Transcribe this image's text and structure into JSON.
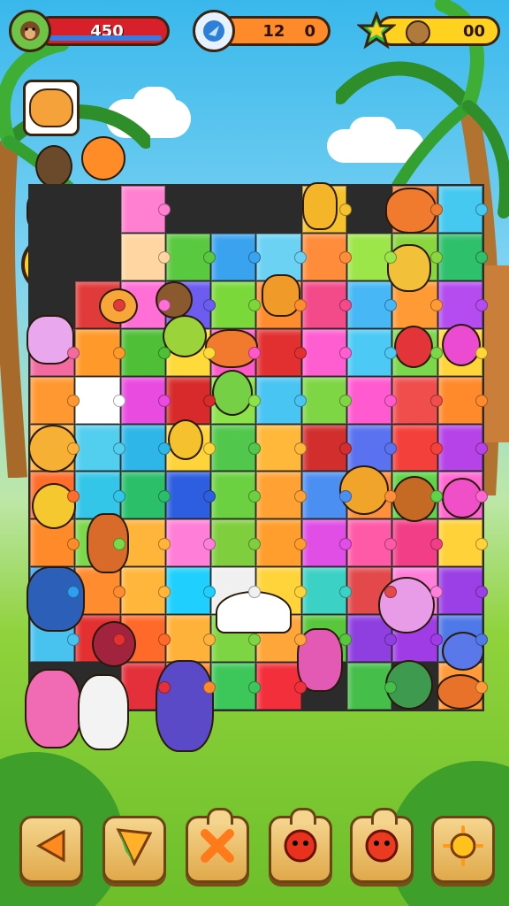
{
  "hud": {
    "lives": {
      "value": "450",
      "icon": "monkey-face-icon",
      "bar_color": "#d8202a",
      "bar_fill": 0.93
    },
    "timer": {
      "value": "12",
      "secondary": "0",
      "icon": "gem-icon",
      "color": "#ff8a2a"
    },
    "stars": {
      "value": "00",
      "icon": "star-icon",
      "friend_icon": "monkey-face-icon",
      "color": "#ffd21f"
    }
  },
  "sidebar": {
    "portraits": [
      "fox-portrait",
      "coconut-portrait",
      "pig-portrait",
      "bird-portrait"
    ]
  },
  "board": {
    "columns": 10,
    "rows": 11,
    "pieces": [
      "gap",
      "gap",
      "#ff7fd0",
      "gap",
      "gap",
      "gap",
      "#f6c22b",
      "gap",
      "#f07a2d",
      "#46c9f0",
      "gap",
      "gap",
      "#ffd6a1",
      "#59c93f",
      "#3aa3f0",
      "#6bd2f4",
      "#ff8c3b",
      "#9de64a",
      "#8ad63e",
      "#2ec06b",
      "gap",
      "#e03a3a",
      "#ff6fd6",
      "#6c5cf0",
      "#7bd83b",
      "#ff8d2f",
      "#f34a8a",
      "#47b8f5",
      "#ff9a35",
      "#b44cf0",
      "#f26aa0",
      "#ff9a2a",
      "#4fbf37",
      "#ffda3a",
      "#ff58c8",
      "#e23030",
      "#ff5ed1",
      "#4ccaf5",
      "#7ad84a",
      "#ffd53a",
      "#ff9830",
      "#ffffff",
      "#e94ae0",
      "#d82a2a",
      "#8be34a",
      "#49c5f3",
      "#7ed645",
      "#ff5ad0",
      "#f04d4d",
      "#ff8a2c",
      "#ffb13a",
      "#52cfee",
      "#2eb6e8",
      "#ffd43a",
      "#51c84c",
      "#ffb83a",
      "#d22e2e",
      "#5a72f0",
      "#f4403a",
      "#b643e8",
      "#ff6d2a",
      "#34c6e8",
      "#2bbf6a",
      "#2e5ee0",
      "#6cd141",
      "#ffa233",
      "#4c8ff2",
      "#ff8f3a",
      "#5ed446",
      "#ff66d0",
      "#ff8a2a",
      "#7ad84a",
      "#ffb43a",
      "#ff7fd8",
      "#7fce3e",
      "#ff9e2c",
      "#e04ee6",
      "#ff5aa8",
      "#f23e86",
      "#ffd23a",
      "#2f9df0",
      "#ff8c2f",
      "#ffb63b",
      "#1fd0ff",
      "#f0f0f0",
      "#ffd43a",
      "#3bd1c4",
      "#e3484a",
      "#ff7fda",
      "#9b3fe6",
      "#48c2ef",
      "#e43030",
      "#ff6a2a",
      "#ffb23a",
      "#7ed544",
      "#ffa63a",
      "#58c73c",
      "#8f3fe0",
      "#a03ce6",
      "#4f78e8",
      "gap",
      "gap",
      "#e3303a",
      "#ff8a2d",
      "#3dc75a",
      "#f22f3a",
      "gap",
      "#45be4a",
      "gap",
      "#ff9a3a"
    ]
  },
  "controls": {
    "back_icon": "back-arrow-icon",
    "hint_icon": "pencil-hint-icon",
    "shuffle_icon": "cross-shuffle-icon",
    "tool3_icon": "red-blob-icon",
    "tool4_icon": "red-blob-icon",
    "tool5_icon": "sun-icon"
  }
}
